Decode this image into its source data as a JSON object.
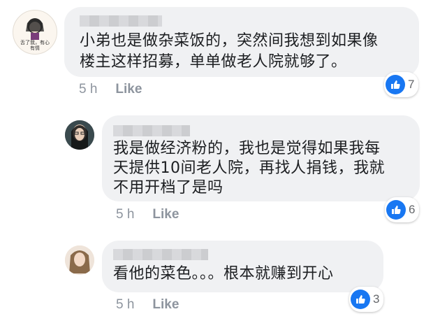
{
  "comments": [
    {
      "avatar_caption": "舌了我，有心有情",
      "text_line1": "小弟也是做杂菜饭的，突然间我想到如果像",
      "text_line2": "楼主这样招募，单单做老人院就够了。",
      "time": "5 h",
      "like_label": "Like",
      "reactions": "7"
    },
    {
      "text_line1": "我是做经济粉的，我也是觉得如果我每",
      "text_line2": "天提供10间老人院，再找人捐钱，我就",
      "text_line3": "不用开档了是吗",
      "time": "5 h",
      "like_label": "Like",
      "reactions": "6"
    },
    {
      "text_line1": "看他的菜色。。。根本就赚到开心",
      "time": "5 h",
      "like_label": "Like",
      "reactions": "3"
    }
  ],
  "colors": {
    "bubble": "#f0f1f3",
    "like_blue": "#1877f2",
    "meta_gray": "#8d949e"
  }
}
